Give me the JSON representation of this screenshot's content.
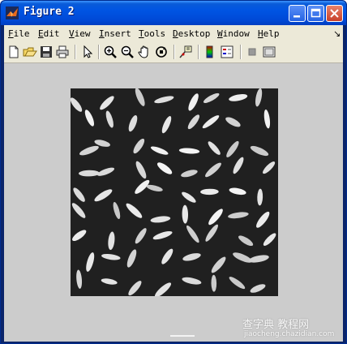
{
  "window": {
    "title": "Figure 2"
  },
  "menu": {
    "items": [
      {
        "label": "File"
      },
      {
        "label": "Edit"
      },
      {
        "label": "View"
      },
      {
        "label": "Insert"
      },
      {
        "label": "Tools"
      },
      {
        "label": "Desktop"
      },
      {
        "label": "Window"
      },
      {
        "label": "Help"
      }
    ]
  },
  "toolbar": {
    "buttons": [
      {
        "icon": "new-figure-icon"
      },
      {
        "icon": "open-file-icon"
      },
      {
        "icon": "save-figure-icon"
      },
      {
        "icon": "print-figure-icon"
      },
      {
        "icon": "edit-plot-arrow-icon"
      },
      {
        "icon": "zoom-in-icon"
      },
      {
        "icon": "zoom-out-icon"
      },
      {
        "icon": "pan-hand-icon"
      },
      {
        "icon": "rotate-3d-icon"
      },
      {
        "icon": "data-cursor-icon"
      },
      {
        "icon": "insert-colorbar-icon"
      },
      {
        "icon": "insert-legend-icon"
      },
      {
        "icon": "hide-plot-tools-icon"
      },
      {
        "icon": "show-plot-tools-icon"
      }
    ]
  },
  "figure": {
    "background": "#cccccc",
    "image_content": "grayscale image of rice grains on dark background"
  },
  "watermark": {
    "text": "查字典 教程网",
    "url": "jiaocheng.chazidian.com"
  },
  "colors": {
    "titlebar": "#0054e3",
    "menubar": "#ece9d8",
    "figure_bg": "#cccccc",
    "image_bg": "#1a1a1a",
    "grain": "#e0e0e0"
  }
}
